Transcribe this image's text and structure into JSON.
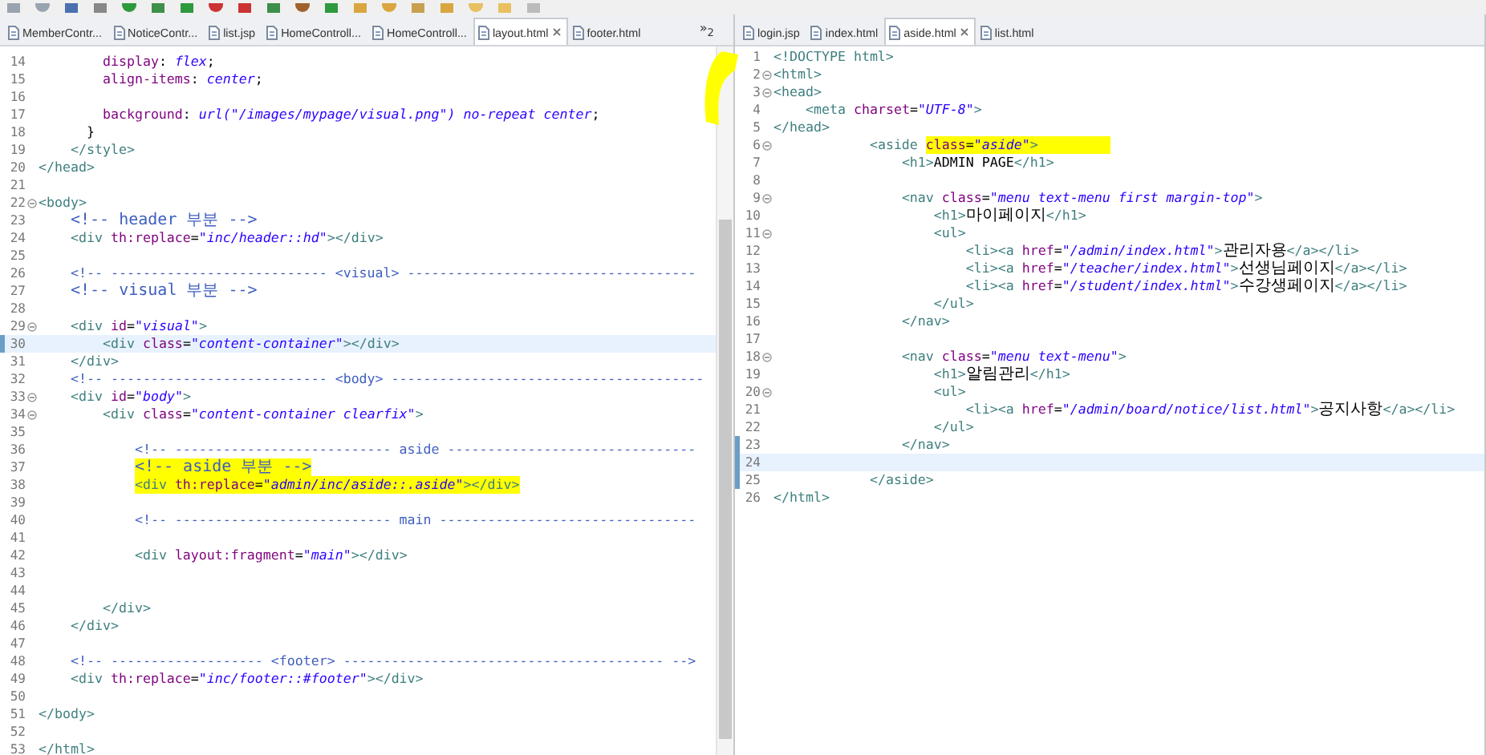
{
  "left_editor": {
    "tabs": [
      {
        "label": "MemberContr...",
        "selected": false,
        "closable": false
      },
      {
        "label": "NoticeContr...",
        "selected": false,
        "closable": false
      },
      {
        "label": "list.jsp",
        "selected": false,
        "closable": false
      },
      {
        "label": "HomeControll...",
        "selected": false,
        "closable": false
      },
      {
        "label": "HomeControll...",
        "selected": false,
        "closable": false
      },
      {
        "label": "layout.html",
        "selected": true,
        "closable": true
      },
      {
        "label": "footer.html",
        "selected": false,
        "closable": false
      }
    ],
    "overflow": "»$_{2}$",
    "lines": [
      {
        "number": "14",
        "tokens": [
          {
            "kind": "attr",
            "text": "        display"
          },
          {
            "kind": "plain",
            "text": ": "
          },
          {
            "kind": "cssvalue",
            "text": "flex"
          },
          {
            "kind": "plain",
            "text": ";"
          }
        ]
      },
      {
        "number": "15",
        "tokens": [
          {
            "kind": "attr",
            "text": "        align-items"
          },
          {
            "kind": "plain",
            "text": ": "
          },
          {
            "kind": "cssvalue",
            "text": "center"
          },
          {
            "kind": "plain",
            "text": ";"
          }
        ]
      },
      {
        "number": "16"
      },
      {
        "number": "17",
        "tokens": [
          {
            "kind": "attr",
            "text": "        background"
          },
          {
            "kind": "plain",
            "text": ": "
          },
          {
            "kind": "cssvalue",
            "text": "url(\"/images/mypage/visual.png\") no-repeat center"
          },
          {
            "kind": "plain",
            "text": ";"
          }
        ]
      },
      {
        "number": "18",
        "tokens": [
          {
            "kind": "plain",
            "text": "      }"
          }
        ]
      },
      {
        "number": "19",
        "tokens": [
          {
            "kind": "tag",
            "text": "    </style>"
          }
        ]
      },
      {
        "number": "20",
        "tokens": [
          {
            "kind": "tag",
            "text": "</head>"
          }
        ]
      },
      {
        "number": "21"
      },
      {
        "number": "22",
        "fold": true,
        "tokens": [
          {
            "kind": "tag",
            "text": "<body>"
          }
        ]
      },
      {
        "number": "23",
        "tokens": [
          {
            "kind": "comment",
            "text": "    <!-- header 부분 -->"
          }
        ]
      },
      {
        "number": "24",
        "tokens": [
          {
            "kind": "tag",
            "text": "    <div "
          },
          {
            "kind": "attr",
            "text": "th:replace"
          },
          {
            "kind": "plain",
            "text": "="
          },
          {
            "kind": "value",
            "text": "\"inc/header::hd\""
          },
          {
            "kind": "tag",
            "text": "></div>"
          }
        ]
      },
      {
        "number": "25"
      },
      {
        "number": "26",
        "tokens": [
          {
            "kind": "comment",
            "text": "    <!-- --------------------------- <visual> ------------------------------------"
          }
        ]
      },
      {
        "number": "27",
        "tokens": [
          {
            "kind": "comment",
            "text": "    <!-- visual 부분 -->"
          }
        ]
      },
      {
        "number": "28"
      },
      {
        "number": "29",
        "fold": true,
        "tokens": [
          {
            "kind": "tag",
            "text": "    <div "
          },
          {
            "kind": "attr",
            "text": "id"
          },
          {
            "kind": "plain",
            "text": "="
          },
          {
            "kind": "value",
            "text": "\"visual\""
          },
          {
            "kind": "tag",
            "text": ">"
          }
        ]
      },
      {
        "number": "30",
        "current": true,
        "changed": true,
        "tokens": [
          {
            "kind": "tag",
            "text": "        <div "
          },
          {
            "kind": "attr",
            "text": "class"
          },
          {
            "kind": "plain",
            "text": "="
          },
          {
            "kind": "value",
            "text": "\"content-container\""
          },
          {
            "kind": "tag",
            "text": "></div>"
          }
        ]
      },
      {
        "number": "31",
        "tokens": [
          {
            "kind": "tag",
            "text": "    </div>"
          }
        ]
      },
      {
        "number": "32",
        "tokens": [
          {
            "kind": "comment",
            "text": "    <!-- --------------------------- <body> ---------------------------------------"
          }
        ]
      },
      {
        "number": "33",
        "fold": true,
        "tokens": [
          {
            "kind": "tag",
            "text": "    <div "
          },
          {
            "kind": "attr",
            "text": "id"
          },
          {
            "kind": "plain",
            "text": "="
          },
          {
            "kind": "value",
            "text": "\"body\""
          },
          {
            "kind": "tag",
            "text": ">"
          }
        ]
      },
      {
        "number": "34",
        "fold": true,
        "tokens": [
          {
            "kind": "tag",
            "text": "        <div "
          },
          {
            "kind": "attr",
            "text": "class"
          },
          {
            "kind": "plain",
            "text": "="
          },
          {
            "kind": "value",
            "text": "\"content-container clearfix\""
          },
          {
            "kind": "tag",
            "text": ">"
          }
        ]
      },
      {
        "number": "35"
      },
      {
        "number": "36",
        "tokens": [
          {
            "kind": "comment",
            "text": "            <!-- --------------------------- aside -------------------------------"
          }
        ]
      },
      {
        "number": "37",
        "tokens": [
          {
            "kind": "comment",
            "text": "            <!-- aside 부분 -->",
            "marked": true
          }
        ]
      },
      {
        "number": "38",
        "tokens": [
          {
            "kind": "tag",
            "text": "            <div ",
            "marked": true
          },
          {
            "kind": "attr",
            "text": "th:replace",
            "marked": true
          },
          {
            "kind": "plain",
            "text": "=",
            "marked": true
          },
          {
            "kind": "value",
            "text": "\"admin/inc/aside::.aside\"",
            "marked": true
          },
          {
            "kind": "tag",
            "text": "></div>",
            "marked": true
          }
        ]
      },
      {
        "number": "39"
      },
      {
        "number": "40",
        "tokens": [
          {
            "kind": "comment",
            "text": "            <!-- --------------------------- main --------------------------------"
          }
        ]
      },
      {
        "number": "41"
      },
      {
        "number": "42",
        "tokens": [
          {
            "kind": "tag",
            "text": "            <div "
          },
          {
            "kind": "attr",
            "text": "layout:fragment"
          },
          {
            "kind": "plain",
            "text": "="
          },
          {
            "kind": "value",
            "text": "\"main\""
          },
          {
            "kind": "tag",
            "text": "></div>"
          }
        ]
      },
      {
        "number": "43"
      },
      {
        "number": "44"
      },
      {
        "number": "45",
        "tokens": [
          {
            "kind": "tag",
            "text": "        </div>"
          }
        ]
      },
      {
        "number": "46",
        "tokens": [
          {
            "kind": "tag",
            "text": "    </div>"
          }
        ]
      },
      {
        "number": "47"
      },
      {
        "number": "48",
        "tokens": [
          {
            "kind": "comment",
            "text": "    <!-- ------------------- <footer> ---------------------------------------- -->"
          }
        ]
      },
      {
        "number": "49",
        "tokens": [
          {
            "kind": "tag",
            "text": "    <div "
          },
          {
            "kind": "attr",
            "text": "th:replace"
          },
          {
            "kind": "plain",
            "text": "="
          },
          {
            "kind": "value",
            "text": "\"inc/footer::#footer\""
          },
          {
            "kind": "tag",
            "text": "></div>"
          }
        ]
      },
      {
        "number": "50"
      },
      {
        "number": "51",
        "tokens": [
          {
            "kind": "tag",
            "text": "</body>"
          }
        ]
      },
      {
        "number": "52"
      },
      {
        "number": "53",
        "tokens": [
          {
            "kind": "tag",
            "text": "</html>"
          }
        ]
      }
    ]
  },
  "right_editor": {
    "tabs": [
      {
        "label": "login.jsp",
        "selected": false,
        "closable": false
      },
      {
        "label": "index.html",
        "selected": false,
        "closable": false
      },
      {
        "label": "aside.html",
        "selected": true,
        "closable": true
      },
      {
        "label": "list.html",
        "selected": false,
        "closable": false
      }
    ],
    "lines": [
      {
        "number": "1",
        "tokens": [
          {
            "kind": "tag",
            "text": "<!DOCTYPE html>"
          }
        ]
      },
      {
        "number": "2",
        "fold": true,
        "tokens": [
          {
            "kind": "tag",
            "text": "<html>"
          }
        ]
      },
      {
        "number": "3",
        "fold": true,
        "tokens": [
          {
            "kind": "tag",
            "text": "<head>"
          }
        ]
      },
      {
        "number": "4",
        "tokens": [
          {
            "kind": "tag",
            "text": "    <meta "
          },
          {
            "kind": "attr",
            "text": "charset"
          },
          {
            "kind": "plain",
            "text": "="
          },
          {
            "kind": "value",
            "text": "\"UTF-8\""
          },
          {
            "kind": "tag",
            "text": ">"
          }
        ]
      },
      {
        "number": "5",
        "tokens": [
          {
            "kind": "tag",
            "text": "</head>"
          }
        ]
      },
      {
        "number": "6",
        "fold": true,
        "tokens": [
          {
            "kind": "tag",
            "text": "            <aside "
          },
          {
            "kind": "attr",
            "text": "class",
            "marked": true
          },
          {
            "kind": "plain",
            "text": "=",
            "marked": true
          },
          {
            "kind": "value",
            "text": "\"aside\"",
            "marked": true
          },
          {
            "kind": "tag",
            "text": ">         ",
            "marked": true
          }
        ]
      },
      {
        "number": "7",
        "tokens": [
          {
            "kind": "tag",
            "text": "                <h1>"
          },
          {
            "kind": "plain",
            "text": "ADMIN PAGE"
          },
          {
            "kind": "tag",
            "text": "</h1>"
          }
        ]
      },
      {
        "number": "8"
      },
      {
        "number": "9",
        "fold": true,
        "tokens": [
          {
            "kind": "tag",
            "text": "                <nav "
          },
          {
            "kind": "attr",
            "text": "class"
          },
          {
            "kind": "plain",
            "text": "="
          },
          {
            "kind": "value",
            "text": "\"menu text-menu first margin-top\""
          },
          {
            "kind": "tag",
            "text": ">"
          }
        ]
      },
      {
        "number": "10",
        "tokens": [
          {
            "kind": "tag",
            "text": "                    <h1>"
          },
          {
            "kind": "plain",
            "text": "마이페이지"
          },
          {
            "kind": "tag",
            "text": "</h1>"
          }
        ]
      },
      {
        "number": "11",
        "fold": true,
        "tokens": [
          {
            "kind": "tag",
            "text": "                    <ul>"
          }
        ]
      },
      {
        "number": "12",
        "tokens": [
          {
            "kind": "tag",
            "text": "                        <li><a "
          },
          {
            "kind": "attr",
            "text": "href"
          },
          {
            "kind": "plain",
            "text": "="
          },
          {
            "kind": "value",
            "text": "\"/admin/index.html\""
          },
          {
            "kind": "tag",
            "text": ">"
          },
          {
            "kind": "plain",
            "text": "관리자용"
          },
          {
            "kind": "tag",
            "text": "</a></li>"
          }
        ]
      },
      {
        "number": "13",
        "tokens": [
          {
            "kind": "tag",
            "text": "                        <li><a "
          },
          {
            "kind": "attr",
            "text": "href"
          },
          {
            "kind": "plain",
            "text": "="
          },
          {
            "kind": "value",
            "text": "\"/teacher/index.html\""
          },
          {
            "kind": "tag",
            "text": ">"
          },
          {
            "kind": "plain",
            "text": "선생님페이지"
          },
          {
            "kind": "tag",
            "text": "</a></li>"
          }
        ]
      },
      {
        "number": "14",
        "tokens": [
          {
            "kind": "tag",
            "text": "                        <li><a "
          },
          {
            "kind": "attr",
            "text": "href"
          },
          {
            "kind": "plain",
            "text": "="
          },
          {
            "kind": "value",
            "text": "\"/student/index.html\""
          },
          {
            "kind": "tag",
            "text": ">"
          },
          {
            "kind": "plain",
            "text": "수강생페이지"
          },
          {
            "kind": "tag",
            "text": "</a></li>"
          }
        ]
      },
      {
        "number": "15",
        "tokens": [
          {
            "kind": "tag",
            "text": "                    </ul>"
          }
        ]
      },
      {
        "number": "16",
        "tokens": [
          {
            "kind": "tag",
            "text": "                </nav>"
          }
        ]
      },
      {
        "number": "17"
      },
      {
        "number": "18",
        "fold": true,
        "tokens": [
          {
            "kind": "tag",
            "text": "                <nav "
          },
          {
            "kind": "attr",
            "text": "class"
          },
          {
            "kind": "plain",
            "text": "="
          },
          {
            "kind": "value",
            "text": "\"menu text-menu\""
          },
          {
            "kind": "tag",
            "text": ">"
          }
        ]
      },
      {
        "number": "19",
        "tokens": [
          {
            "kind": "tag",
            "text": "                    <h1>"
          },
          {
            "kind": "plain",
            "text": "알림관리"
          },
          {
            "kind": "tag",
            "text": "</h1>"
          }
        ]
      },
      {
        "number": "20",
        "fold": true,
        "tokens": [
          {
            "kind": "tag",
            "text": "                    <ul>"
          }
        ]
      },
      {
        "number": "21",
        "tokens": [
          {
            "kind": "tag",
            "text": "                        <li><a "
          },
          {
            "kind": "attr",
            "text": "href"
          },
          {
            "kind": "plain",
            "text": "="
          },
          {
            "kind": "value",
            "text": "\"/admin/board/notice/list.html\""
          },
          {
            "kind": "tag",
            "text": ">"
          },
          {
            "kind": "plain",
            "text": "공지사항"
          },
          {
            "kind": "tag",
            "text": "</a></li>"
          }
        ]
      },
      {
        "number": "22",
        "tokens": [
          {
            "kind": "tag",
            "text": "                    </ul>"
          }
        ]
      },
      {
        "number": "23",
        "changed": true,
        "tokens": [
          {
            "kind": "tag",
            "text": "                </nav>"
          }
        ]
      },
      {
        "number": "24",
        "current": true,
        "changed": true
      },
      {
        "number": "25",
        "changed": true,
        "tokens": [
          {
            "kind": "tag",
            "text": "            </aside>"
          }
        ]
      },
      {
        "number": "26",
        "tokens": [
          {
            "kind": "tag",
            "text": "</html>"
          }
        ]
      }
    ]
  }
}
